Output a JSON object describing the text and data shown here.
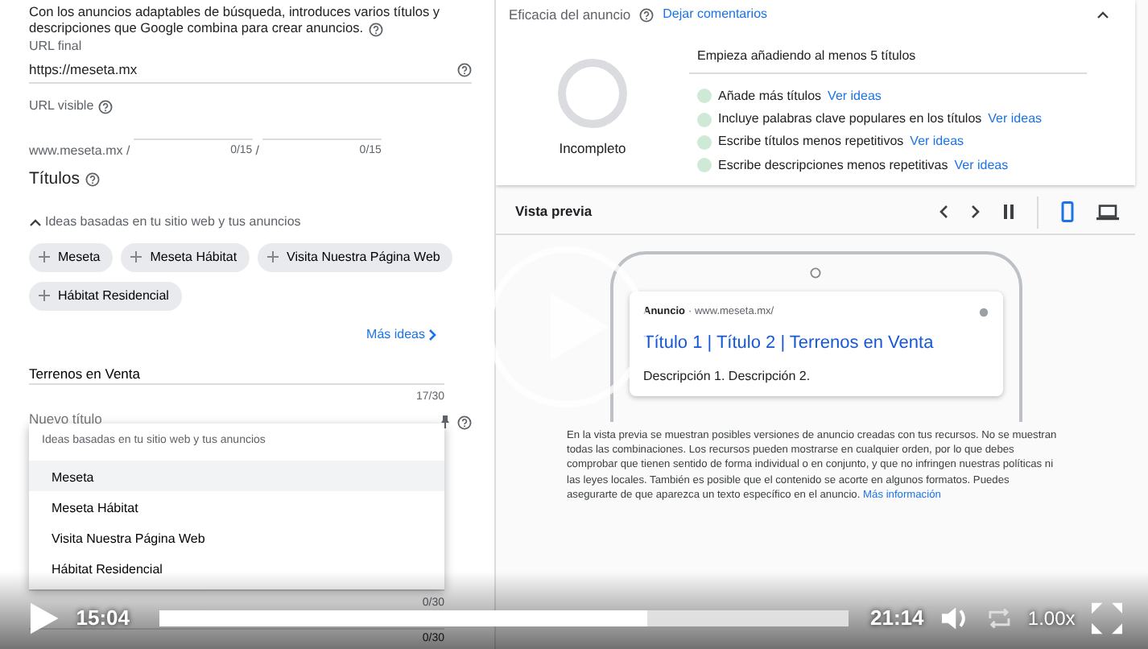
{
  "form": {
    "intro": "Con los anuncios adaptables de búsqueda, introduces varios títulos y descripciones que Google combina para crear anuncios.",
    "final_url": {
      "label": "URL final",
      "value": "https://meseta.mx"
    },
    "visible_url": {
      "label": "URL visible",
      "domain": "www.meseta.mx /",
      "separator": "/",
      "paths": [
        {
          "counter": "0/15"
        },
        {
          "counter": "0/15"
        }
      ]
    },
    "titles": {
      "heading": "Títulos",
      "ideas_toggle": {
        "label": "Ideas basadas en tu sitio web y tus anuncios",
        "expanded": true
      },
      "chips": [
        {
          "label": "Meseta"
        },
        {
          "label": "Meseta Hábitat"
        },
        {
          "label": "Visita Nuestra Página Web"
        },
        {
          "label": "Hábitat Residencial"
        }
      ],
      "more_ideas": "Más ideas",
      "fields": [
        {
          "value": "Terrenos en Venta",
          "counter": "17/30",
          "focused": false
        },
        {
          "placeholder": "Nuevo título",
          "focused": true
        },
        {
          "counter": "0/30",
          "focused": false
        },
        {
          "counter": "0/30"
        }
      ],
      "dropdown": {
        "header": "Ideas basadas en tu sitio web y tus anuncios",
        "items": [
          {
            "label": "Meseta",
            "selected": true
          },
          {
            "label": "Meseta Hábitat",
            "selected": false
          },
          {
            "label": "Visita Nuestra Página Web",
            "selected": false
          },
          {
            "label": "Hábitat Residencial",
            "selected": false
          }
        ]
      }
    }
  },
  "ad_strength": {
    "title": "Eficacia del anuncio",
    "feedback_link": "Dejar comentarios",
    "expanded": true,
    "status": "Incompleto",
    "headline": "Empieza añadiendo al menos 5 títulos",
    "tips": [
      {
        "text": "Añade más títulos",
        "link": "Ver ideas",
        "color": "#ceead6"
      },
      {
        "text": "Incluye palabras clave populares en los títulos",
        "link": "Ver ideas",
        "color": "#ceead6"
      },
      {
        "text": "Escribe títulos menos repetitivos",
        "link": "Ver ideas",
        "color": "#ceead6"
      },
      {
        "text": "Escribe descripciones menos repetitivas",
        "link": "Ver ideas",
        "color": "#ceead6"
      }
    ]
  },
  "preview": {
    "title": "Vista previa",
    "devices": [
      {
        "kind": "mobile",
        "selected": true
      },
      {
        "kind": "desktop",
        "selected": false
      }
    ],
    "ad": {
      "label": "Anuncio",
      "url": "· www.meseta.mx/",
      "headline": "Título 1 | Título 2 | Terrenos en Venta",
      "description": "Descripción 1. Descripción 2."
    },
    "note": "En la vista previa se muestran posibles versiones de anuncio creadas con tus recursos. No se muestran todas las combinaciones. Los recursos pueden mostrarse en cualquier orden, por lo que debes comprobar que tienen sentido de forma individual o en conjunto, y que no infringen nuestras políticas ni las leyes locales. También es posible que el contenido se acorte en algunos formatos. Puedes asegurarte de que aparezca un texto específico en el anuncio.",
    "note_link": "Más información"
  },
  "player": {
    "playing": false,
    "current_time": "15:04",
    "duration": "21:14",
    "level": 0.71,
    "speed": "1.00x"
  }
}
